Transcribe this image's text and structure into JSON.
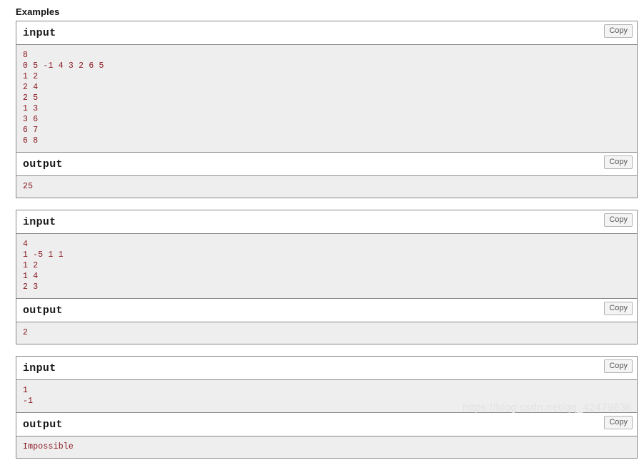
{
  "section": {
    "title": "Examples"
  },
  "labels": {
    "input": "input",
    "output": "output",
    "copy": "Copy"
  },
  "colors": {
    "data_text": "#8b1a22",
    "body_background": "#eeeeee",
    "border": "#888888",
    "header_text": "#1a1a1a",
    "watermark": "#e2e2e2"
  },
  "examples": [
    {
      "input_label": "input",
      "output_label": "output",
      "input_copy_label": "Copy",
      "output_copy_label": "Copy",
      "input_text": "8\n0 5 -1 4 3 2 6 5\n1 2\n2 4\n2 5\n1 3\n3 6\n6 7\n6 8",
      "output_text": "25"
    },
    {
      "input_label": "input",
      "output_label": "output",
      "input_copy_label": "Copy",
      "output_copy_label": "Copy",
      "input_text": "4\n1 -5 1 1\n1 2\n1 4\n2 3",
      "output_text": "2"
    },
    {
      "input_label": "input",
      "output_label": "output",
      "input_copy_label": "Copy",
      "output_copy_label": "Copy",
      "input_text": "1\n-1",
      "output_text": "Impossible"
    }
  ],
  "watermark": {
    "text": "https://blog.csdn.net/qq_42479636"
  }
}
